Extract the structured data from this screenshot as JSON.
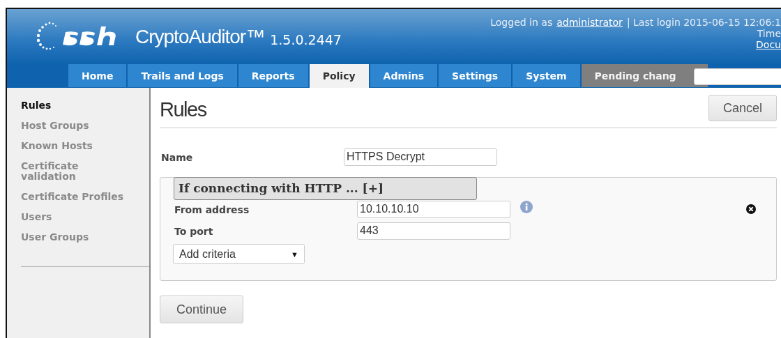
{
  "header": {
    "product": "CryptoAuditor™",
    "version": "1.5.0.2447",
    "login_prefix": "Logged in as",
    "user": "administrator",
    "login_suffix": "| Last login 2015-06-15 12:06:1",
    "line_2": "Time",
    "link": "Docu"
  },
  "tabs": [
    {
      "label": "Home",
      "selected": false,
      "kind": "nav"
    },
    {
      "label": "Trails and Logs",
      "selected": false,
      "kind": "nav"
    },
    {
      "label": "Reports",
      "selected": false,
      "kind": "nav"
    },
    {
      "label": "Policy",
      "selected": true,
      "kind": "nav"
    },
    {
      "label": "Admins",
      "selected": false,
      "kind": "nav"
    },
    {
      "label": "Settings",
      "selected": false,
      "kind": "nav"
    },
    {
      "label": "System",
      "selected": false,
      "kind": "nav"
    },
    {
      "label": "Pending chang",
      "selected": false,
      "kind": "pending"
    }
  ],
  "sidebar": {
    "items": [
      {
        "label": "Rules",
        "selected": true
      },
      {
        "label": "Host Groups",
        "selected": false
      },
      {
        "label": "Known Hosts",
        "selected": false
      },
      {
        "label": "Certificate validation",
        "selected": false
      },
      {
        "label": "Certificate Profiles",
        "selected": false
      },
      {
        "label": "Users",
        "selected": false
      },
      {
        "label": "User Groups",
        "selected": false
      }
    ]
  },
  "page": {
    "title": "Rules",
    "cancel": "Cancel",
    "name_label": "Name",
    "name_value": "HTTPS Decrypt",
    "group": {
      "legend": "If connecting with HTTP ... [+]",
      "fields": [
        {
          "label": "From address",
          "value": "10.10.10.10",
          "info": true
        },
        {
          "label": "To port",
          "value": "443",
          "info": false
        }
      ],
      "add_criteria": "Add criteria",
      "dropdown_arrow": "▼"
    },
    "continue": "Continue"
  }
}
